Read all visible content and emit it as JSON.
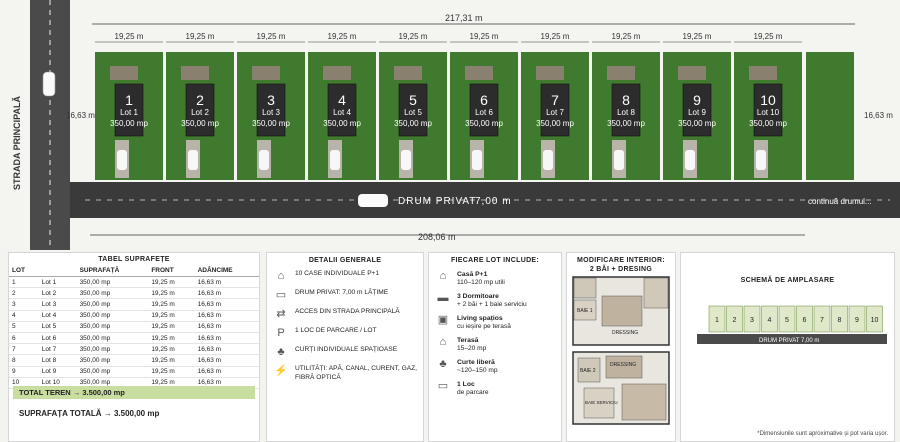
{
  "site": {
    "total_width": "217,31 m",
    "bottom_width": "208,06 m",
    "lot_width": "19,25 m",
    "depth": "16,63 m",
    "road_label": "DRUM PRIVAT",
    "road_width": "7,00 m",
    "continue": "continuă drumul...",
    "main_street": "STRADA PRINCIPALĂ",
    "lots": [
      {
        "num": "1",
        "name": "Lot 1",
        "area": "350,00 mp"
      },
      {
        "num": "2",
        "name": "Lot 2",
        "area": "350,00 mp"
      },
      {
        "num": "3",
        "name": "Lot 3",
        "area": "350,00 mp"
      },
      {
        "num": "4",
        "name": "Lot 4",
        "area": "350,00 mp"
      },
      {
        "num": "5",
        "name": "Lot 5",
        "area": "350,00 mp"
      },
      {
        "num": "6",
        "name": "Lot 6",
        "area": "350,00 mp"
      },
      {
        "num": "7",
        "name": "Lot 7",
        "area": "350,00 mp"
      },
      {
        "num": "8",
        "name": "Lot 8",
        "area": "350,00 mp"
      },
      {
        "num": "9",
        "name": "Lot 9",
        "area": "350,00 mp"
      },
      {
        "num": "10",
        "name": "Lot 10",
        "area": "350,00 mp"
      }
    ]
  },
  "table": {
    "title": "TABEL SUPRAFEȚE",
    "headers": [
      "LOT",
      "",
      "SUPRAFAȚĂ",
      "FRONT",
      "ADÂNCIME"
    ],
    "rows": [
      [
        "1",
        "Lot 1",
        "350,00 mp",
        "19,25 m",
        "16,63 m"
      ],
      [
        "2",
        "Lot 2",
        "350,00 mp",
        "19,25 m",
        "16,63 m"
      ],
      [
        "3",
        "Lot 3",
        "350,00 mp",
        "19,25 m",
        "16,63 m"
      ],
      [
        "4",
        "Lot 4",
        "350,00 mp",
        "19,25 m",
        "16,63 m"
      ],
      [
        "5",
        "Lot 5",
        "350,00 mp",
        "19,25 m",
        "16,63 m"
      ],
      [
        "6",
        "Lot 6",
        "350,00 mp",
        "19,25 m",
        "16,63 m"
      ],
      [
        "7",
        "Lot 7",
        "350,00 mp",
        "19,25 m",
        "16,63 m"
      ],
      [
        "8",
        "Lot 8",
        "350,00 mp",
        "19,25 m",
        "16,63 m"
      ],
      [
        "9",
        "Lot 9",
        "350,00 mp",
        "19,25 m",
        "16,63 m"
      ],
      [
        "10",
        "Lot 10",
        "350,00 mp",
        "19,25 m",
        "16,63 m"
      ]
    ],
    "total": "TOTAL TEREN → 3.500,00 mp",
    "supra": "SUPRAFAȚA TOTALĂ → 3.500,00 mp"
  },
  "details": {
    "title": "DETALII GENERALE",
    "items": [
      "10 CASE INDIVIDUALE P+1",
      "DRUM PRIVAT: 7,00 m LĂȚIME",
      "ACCES DIN STRADA PRINCIPALĂ",
      "1 LOC DE PARCARE / LOT",
      "CURȚI INDIVIDUALE SPAȚIOASE",
      "UTILITĂȚI: APĂ, CANAL, CURENT, GAZ, FIBRĂ OPTICĂ"
    ]
  },
  "includes": {
    "title": "FIECARE LOT INCLUDE:",
    "items": [
      {
        "t": "Casă P+1",
        "s": "110–120 mp utili"
      },
      {
        "t": "3 Dormitoare",
        "s": "+ 2 băi + 1 baie serviciu"
      },
      {
        "t": "Living spațios",
        "s": "cu ieșire pe terasă"
      },
      {
        "t": "Terasă",
        "s": "15–20 mp"
      },
      {
        "t": "Curte liberă",
        "s": "~120–150 mp"
      },
      {
        "t": "1 Loc",
        "s": "de parcare"
      }
    ]
  },
  "interior": {
    "title": "MODIFICARE INTERIOR:",
    "subtitle": "2 BĂI + DRESING",
    "labels": [
      "BAIE 1",
      "DRESSING",
      "BAIE 2",
      "DRESSING",
      "BAIE SERVICIU"
    ]
  },
  "scheme": {
    "title": "SCHEMĂ DE AMPLASARE",
    "nums": [
      "1",
      "2",
      "3",
      "4",
      "5",
      "6",
      "7",
      "8",
      "9",
      "10"
    ],
    "road": "DRUM PRIVAT 7,00 m"
  },
  "note": "*Dimensiunile sunt aproximative și pot varia ușor.",
  "colors": {
    "grass": "#3f7a2e",
    "road": "#3a3a3a",
    "roof": "#2c2c2c",
    "tot": "#c8dea0"
  }
}
